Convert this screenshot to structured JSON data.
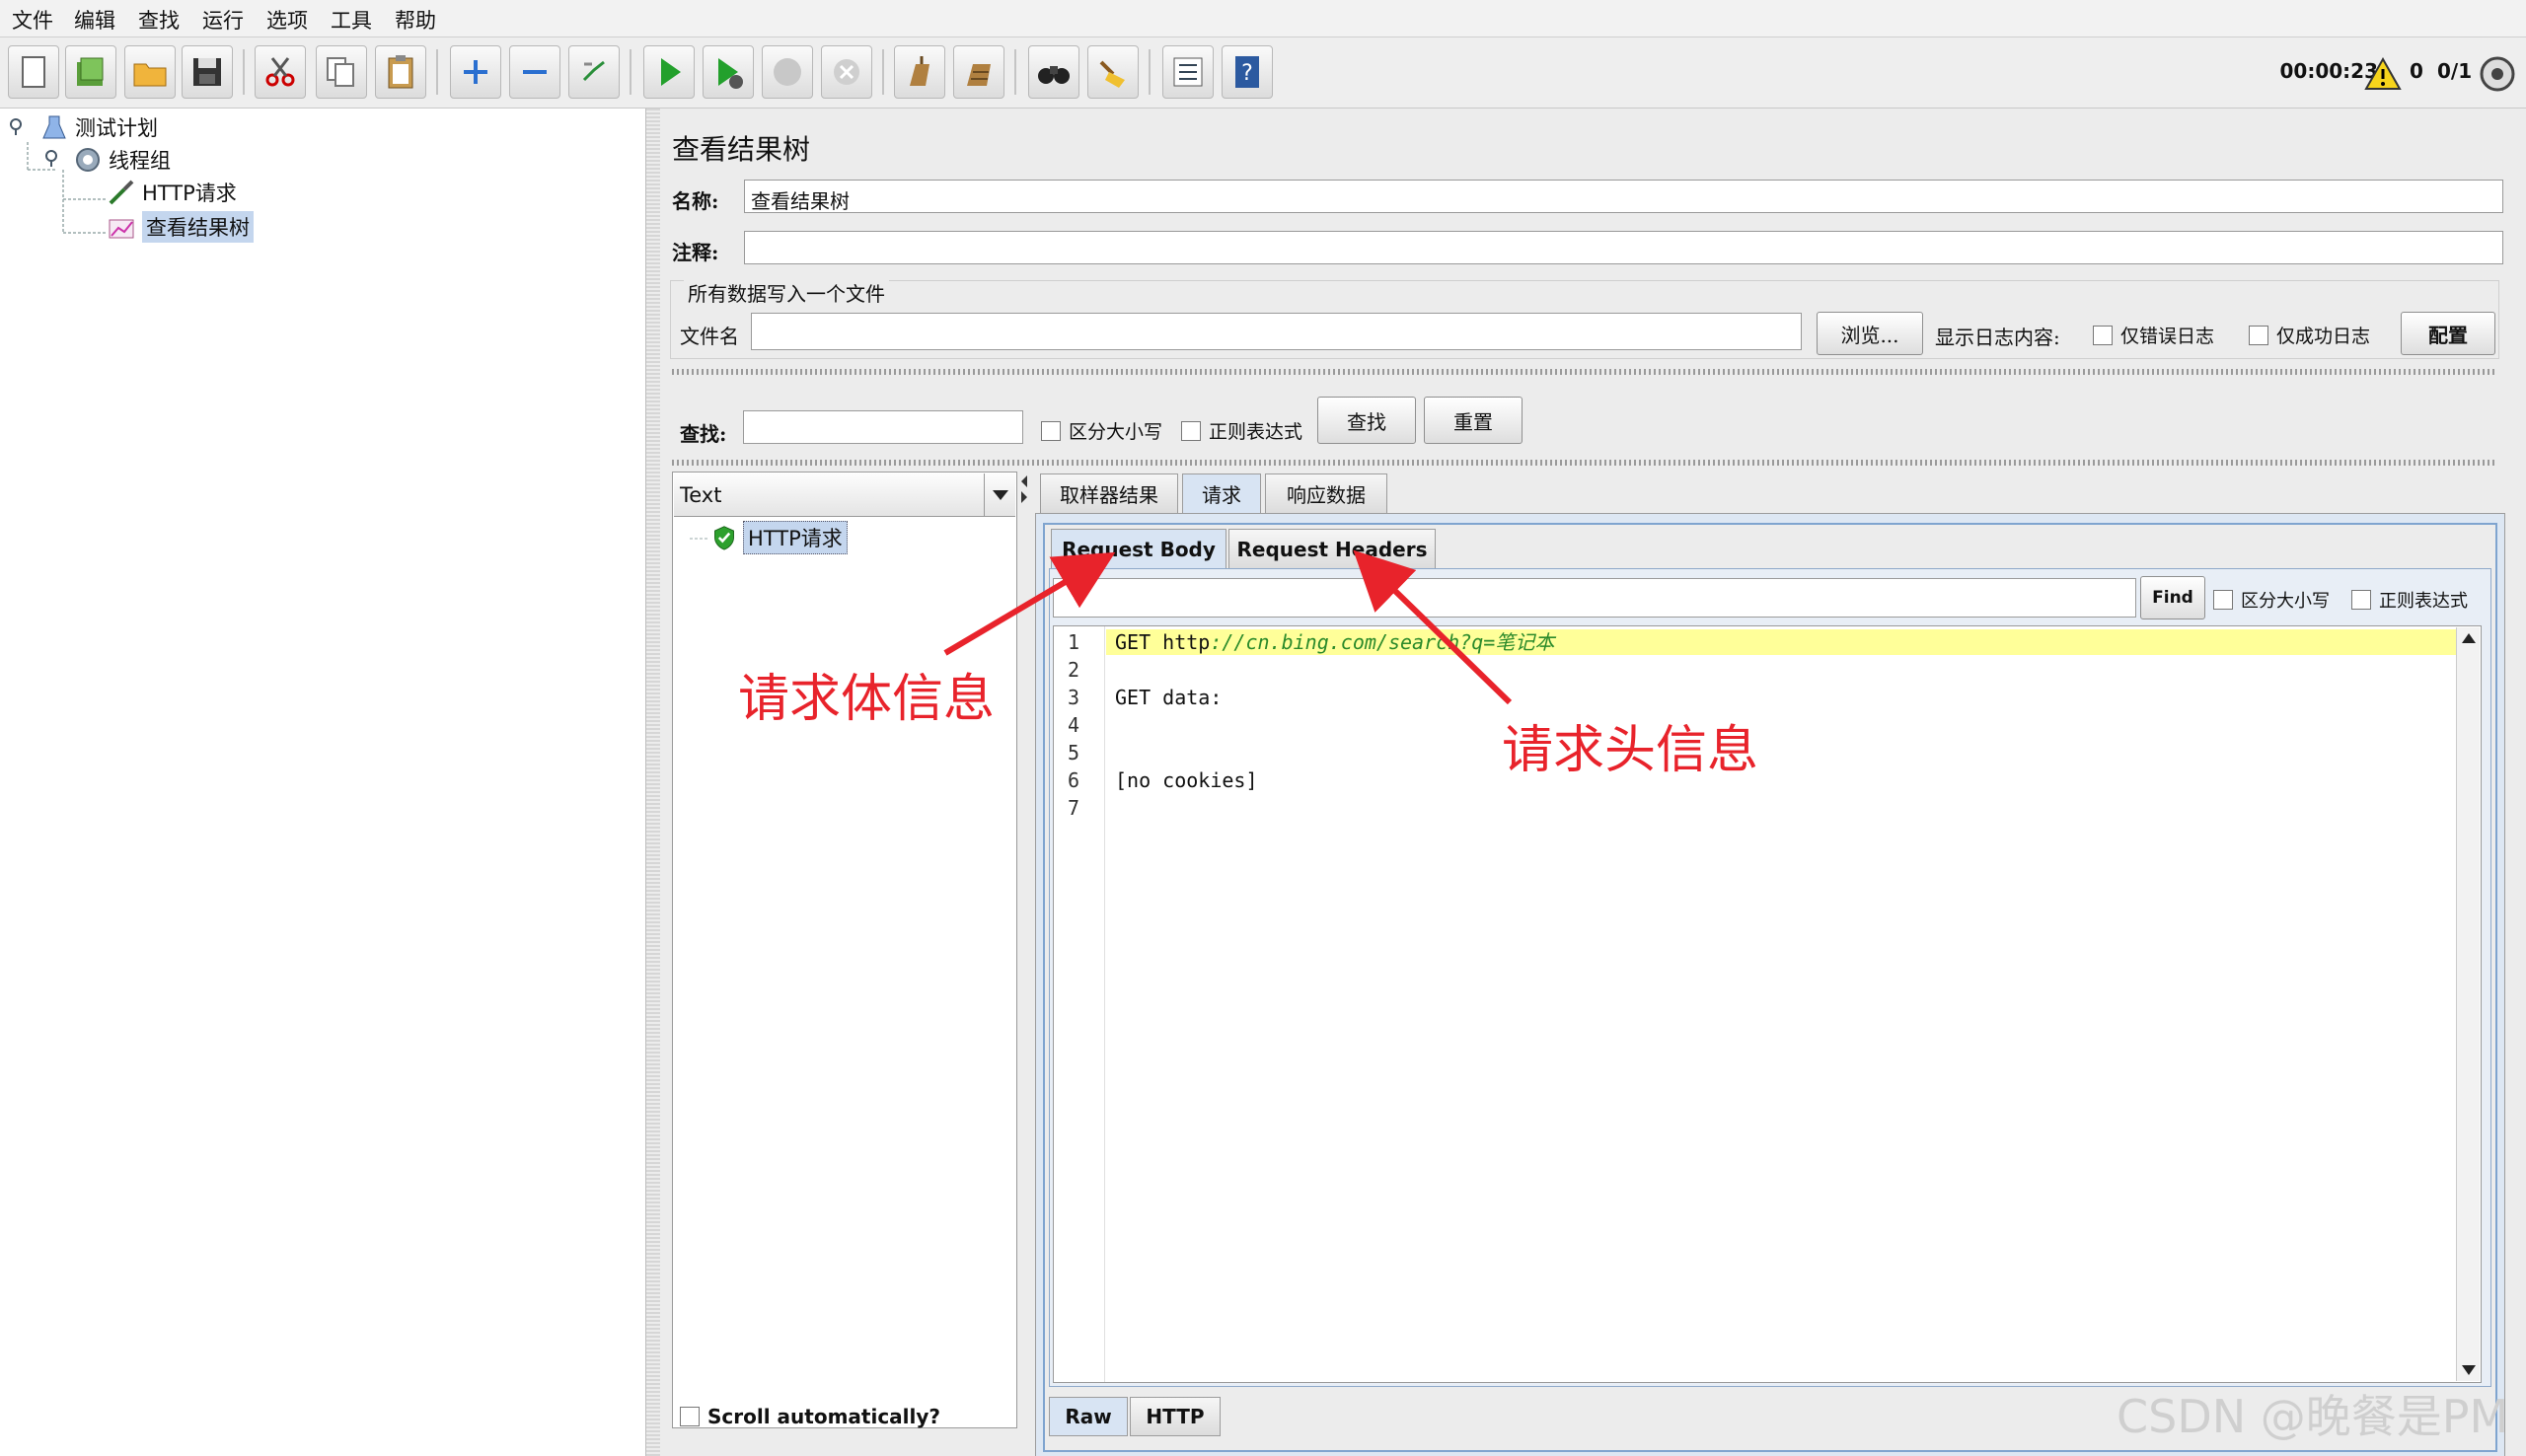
{
  "menu": [
    "文件",
    "编辑",
    "查找",
    "运行",
    "选项",
    "工具",
    "帮助"
  ],
  "toolbar": {
    "timer": "00:00:23",
    "warnings": "0",
    "threads": "0/1"
  },
  "tree": {
    "plan": "测试计划",
    "group": "线程组",
    "sampler": "HTTP请求",
    "listener": "查看结果树"
  },
  "panel": {
    "title": "查看结果树",
    "name_label": "名称:",
    "name_value": "查看结果树",
    "comment_label": "注释:",
    "comment_value": "",
    "file_group": "所有数据写入一个文件",
    "file_label": "文件名",
    "file_value": "",
    "browse": "浏览...",
    "log_label": "显示日志内容:",
    "errors_only": "仅错误日志",
    "success_only": "仅成功日志",
    "configure": "配置"
  },
  "search": {
    "label": "查找:",
    "value": "",
    "case": "区分大小写",
    "regex": "正则表达式",
    "find": "查找",
    "reset": "重置"
  },
  "results": {
    "renderer": "Text",
    "node": "HTTP请求",
    "scroll_auto": "Scroll automatically?"
  },
  "tabs": [
    "取样器结果",
    "请求",
    "响应数据"
  ],
  "subtabs": [
    "Request Body",
    "Request Headers"
  ],
  "find_bar": {
    "value": "",
    "find": "Find",
    "case": "区分大小写",
    "regex": "正则表达式"
  },
  "code_lines": [
    {
      "n": "1",
      "kw": "GET ",
      "plain": "http",
      "url": "://cn.bing.com/search?q=笔记本"
    },
    {
      "n": "2",
      "kw": "",
      "plain": "",
      "url": ""
    },
    {
      "n": "3",
      "kw": "GET data",
      "plain": ":",
      "url": ""
    },
    {
      "n": "4",
      "kw": "",
      "plain": "",
      "url": ""
    },
    {
      "n": "5",
      "kw": "",
      "plain": "",
      "url": ""
    },
    {
      "n": "6",
      "kw": "[no cookies]",
      "plain": "",
      "url": ""
    },
    {
      "n": "7",
      "kw": "",
      "plain": "",
      "url": ""
    }
  ],
  "bottom_tabs": [
    "Raw",
    "HTTP"
  ],
  "annotations": {
    "body": "请求体信息",
    "headers": "请求头信息"
  },
  "watermark": "CSDN @晚餐是PM",
  "colors": {
    "annotation": "#e8232b",
    "highlight": "#ffff99",
    "selection": "#c4d6ee"
  }
}
